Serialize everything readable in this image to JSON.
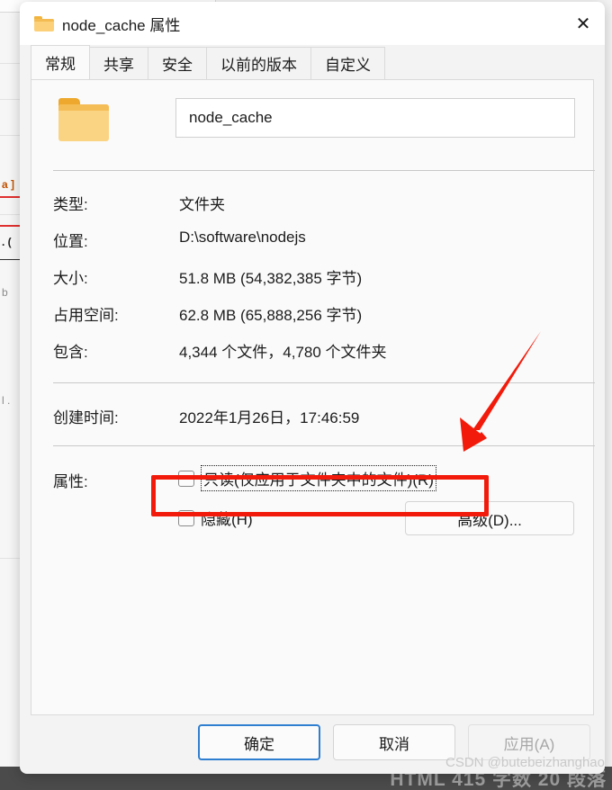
{
  "window": {
    "title": "node_cache 属性",
    "folder_icon": "folder-icon",
    "close_icon": "✕"
  },
  "tabs": [
    {
      "label": "常规",
      "active": true
    },
    {
      "label": "共享",
      "active": false
    },
    {
      "label": "安全",
      "active": false
    },
    {
      "label": "以前的版本",
      "active": false
    },
    {
      "label": "自定义",
      "active": false
    }
  ],
  "general": {
    "folder_name": "node_cache",
    "rows": [
      {
        "label": "类型:",
        "value": "文件夹"
      },
      {
        "label": "位置:",
        "value": "D:\\software\\nodejs"
      },
      {
        "label": "大小:",
        "value": "51.8 MB (54,382,385 字节)"
      },
      {
        "label": "占用空间:",
        "value": "62.8 MB (65,888,256 字节)"
      },
      {
        "label": "包含:",
        "value": "4,344 个文件，4,780 个文件夹"
      }
    ],
    "created": {
      "label": "创建时间:",
      "value": "2022年1月26日，17:46:59"
    },
    "attributes": {
      "label": "属性:",
      "readonly": {
        "label": "只读(仅应用于文件夹中的文件)(R)",
        "checked": false
      },
      "hidden": {
        "label": "隐藏(H)",
        "checked": false
      },
      "advanced_button": "高级(D)..."
    }
  },
  "footer": {
    "ok": "确定",
    "cancel": "取消",
    "apply": "应用(A)"
  },
  "annotations": {
    "highlight_color": "#f21b0b",
    "arrow_target": "只读(仅应用于文件夹中的文件)(R)"
  },
  "host": {
    "statusbar_text": "HTML 415 字数 20 段落",
    "watermark": "CSDN @butebeizhanghao"
  }
}
